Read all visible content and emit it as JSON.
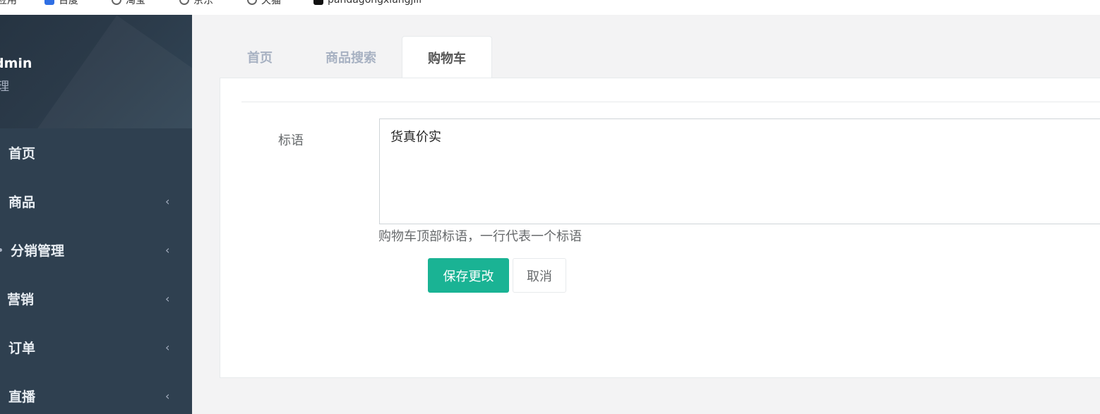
{
  "bookmarks": [
    {
      "label": "应用",
      "icon": "apps-icon"
    },
    {
      "label": "百度",
      "icon": "baidu-icon"
    },
    {
      "label": "淘宝",
      "icon": "globe-icon"
    },
    {
      "label": "京东",
      "icon": "globe-icon"
    },
    {
      "label": "天猫",
      "icon": "globe-icon"
    },
    {
      "label": "pandagongxiangjili",
      "icon": "black-square-icon"
    }
  ],
  "sidebar": {
    "profile": {
      "name": "dmin",
      "role": "理"
    },
    "items": [
      {
        "label": "首页",
        "has_submenu": false
      },
      {
        "label": "商品",
        "has_submenu": true
      },
      {
        "label": "分销管理",
        "has_submenu": true
      },
      {
        "label": "营销",
        "has_submenu": true
      },
      {
        "label": "订单",
        "has_submenu": true
      },
      {
        "label": "直播",
        "has_submenu": true
      }
    ],
    "chevron": "‹"
  },
  "tabs": [
    {
      "label": "首页",
      "active": false
    },
    {
      "label": "商品搜索",
      "active": false
    },
    {
      "label": "购物车",
      "active": true
    }
  ],
  "form": {
    "slogan_label": "标语",
    "slogan_value": "货真价实",
    "slogan_help": "购物车顶部标语，一行代表一个标语",
    "save_label": "保存更改",
    "cancel_label": "取消"
  },
  "colors": {
    "sidebar_bg": "#2f4050",
    "primary": "#1ab394",
    "page_bg": "#f3f3f4"
  }
}
